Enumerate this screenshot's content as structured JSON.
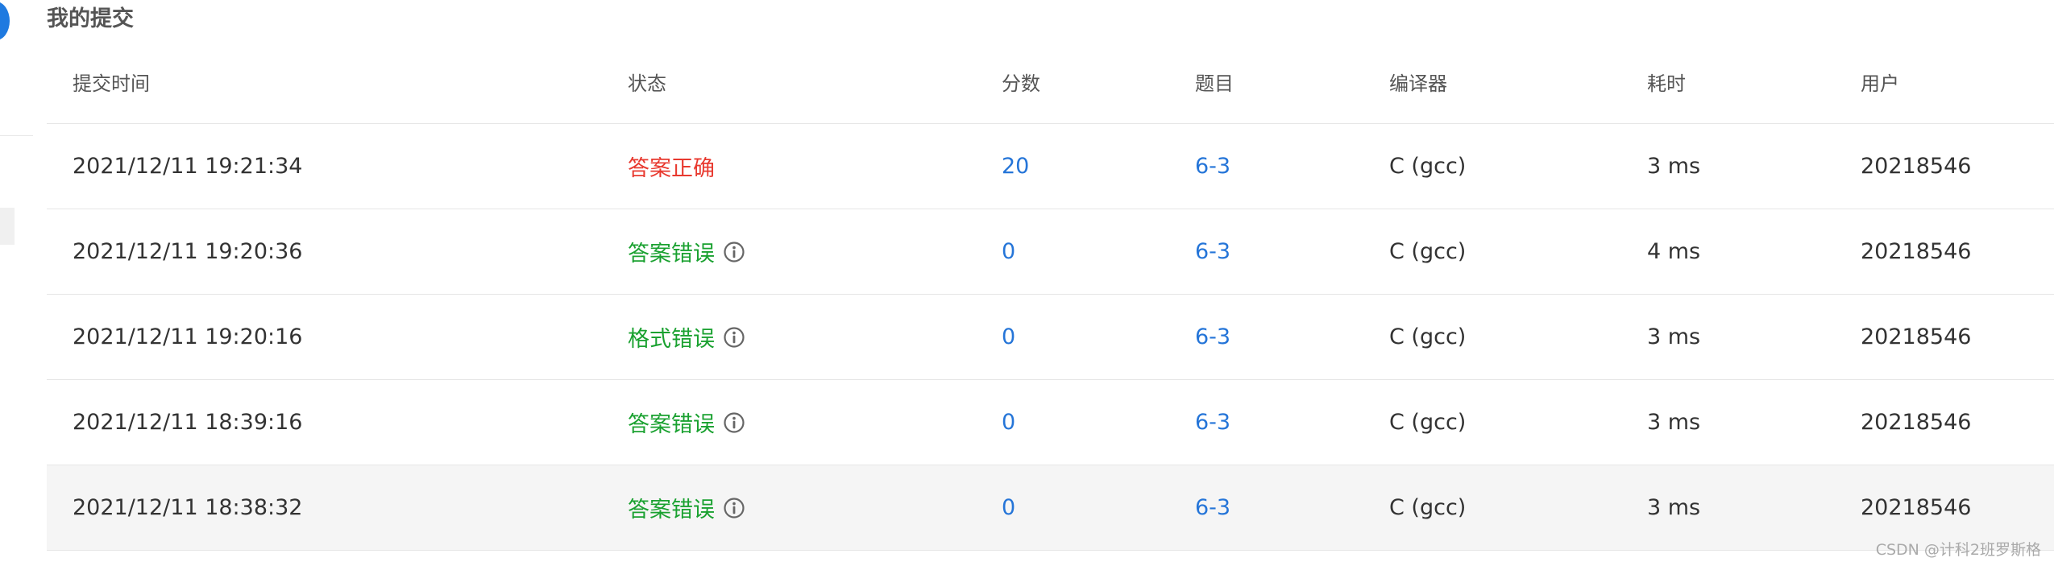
{
  "page": {
    "title": "我的提交",
    "watermark": "CSDN @计科2班罗斯格"
  },
  "colors": {
    "accepted": "#e8392f",
    "wrong": "#1aa130",
    "link": "#2575d8"
  },
  "table": {
    "columns": [
      "提交时间",
      "状态",
      "分数",
      "题目",
      "编译器",
      "耗时",
      "用户"
    ],
    "rows": [
      {
        "time": "2021/12/11 19:21:34",
        "status": "答案正确",
        "score": "20",
        "problem": "6-3",
        "compiler": "C (gcc)",
        "duration": "3 ms",
        "user": "20218546"
      },
      {
        "time": "2021/12/11 19:20:36",
        "status": "答案错误",
        "score": "0",
        "problem": "6-3",
        "compiler": "C (gcc)",
        "duration": "4 ms",
        "user": "20218546"
      },
      {
        "time": "2021/12/11 19:20:16",
        "status": "格式错误",
        "score": "0",
        "problem": "6-3",
        "compiler": "C (gcc)",
        "duration": "3 ms",
        "user": "20218546"
      },
      {
        "time": "2021/12/11 18:39:16",
        "status": "答案错误",
        "score": "0",
        "problem": "6-3",
        "compiler": "C (gcc)",
        "duration": "3 ms",
        "user": "20218546"
      },
      {
        "time": "2021/12/11 18:38:32",
        "status": "答案错误",
        "score": "0",
        "problem": "6-3",
        "compiler": "C (gcc)",
        "duration": "3 ms",
        "user": "20218546"
      }
    ]
  },
  "icons": {
    "info": "info-circle-icon"
  }
}
